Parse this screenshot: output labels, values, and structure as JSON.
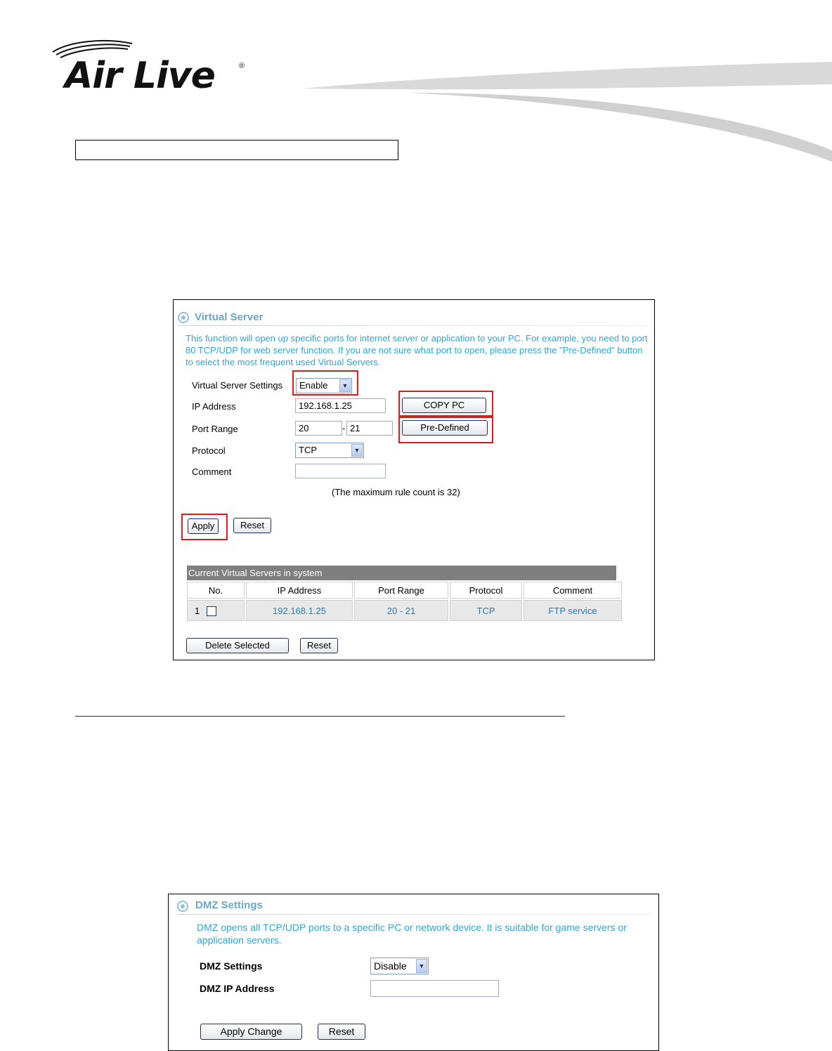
{
  "header": {
    "logo_text": "Air Live",
    "logo_mark": "®"
  },
  "virtual_server": {
    "title": "Virtual Server",
    "description": "This function will open up specific ports for internet server or application to your PC. For example, you need to port 80 TCP/UDP for web server function. If you are not sure what port to open, please press the \"Pre-Defined\" button to select the most frequent used Virtual Servers.",
    "settings_label": "Virtual Server Settings",
    "settings_value": "Enable",
    "ip_label": "IP Address",
    "ip_value": "192.168.1.25",
    "copy_pc_button": "COPY PC",
    "port_label": "Port Range",
    "port_from": "20",
    "port_sep": "-",
    "port_to": "21",
    "predefined_button": "Pre-Defined",
    "protocol_label": "Protocol",
    "protocol_value": "TCP",
    "comment_label": "Comment",
    "comment_value": "",
    "max_rule_note": "(The maximum rule count is 32)",
    "apply_button": "Apply",
    "reset_button": "Reset",
    "table": {
      "caption": "Current Virtual Servers in system",
      "columns": [
        "No.",
        "IP Address",
        "Port Range",
        "Protocol",
        "Comment"
      ],
      "rows": [
        {
          "no": "1",
          "ip": "192.168.1.25",
          "range": "20 - 21",
          "protocol": "TCP",
          "comment": "FTP service"
        }
      ]
    },
    "delete_selected_button": "Delete Selected",
    "table_reset_button": "Reset"
  },
  "dmz": {
    "title": "DMZ Settings",
    "description": "DMZ opens all TCP/UDP ports to a specific PC or network device. It is suitable for game servers or application servers.",
    "settings_label": "DMZ Settings",
    "settings_value": "Disable",
    "ip_label": "DMZ IP Address",
    "ip_value": "",
    "apply_button": "Apply Change",
    "reset_button": "Reset"
  },
  "colors": {
    "accent_text": "#2ba9da",
    "title_text": "#6aa8c8",
    "highlight": "#e11b1b",
    "table_header": "#7f7f7f"
  }
}
